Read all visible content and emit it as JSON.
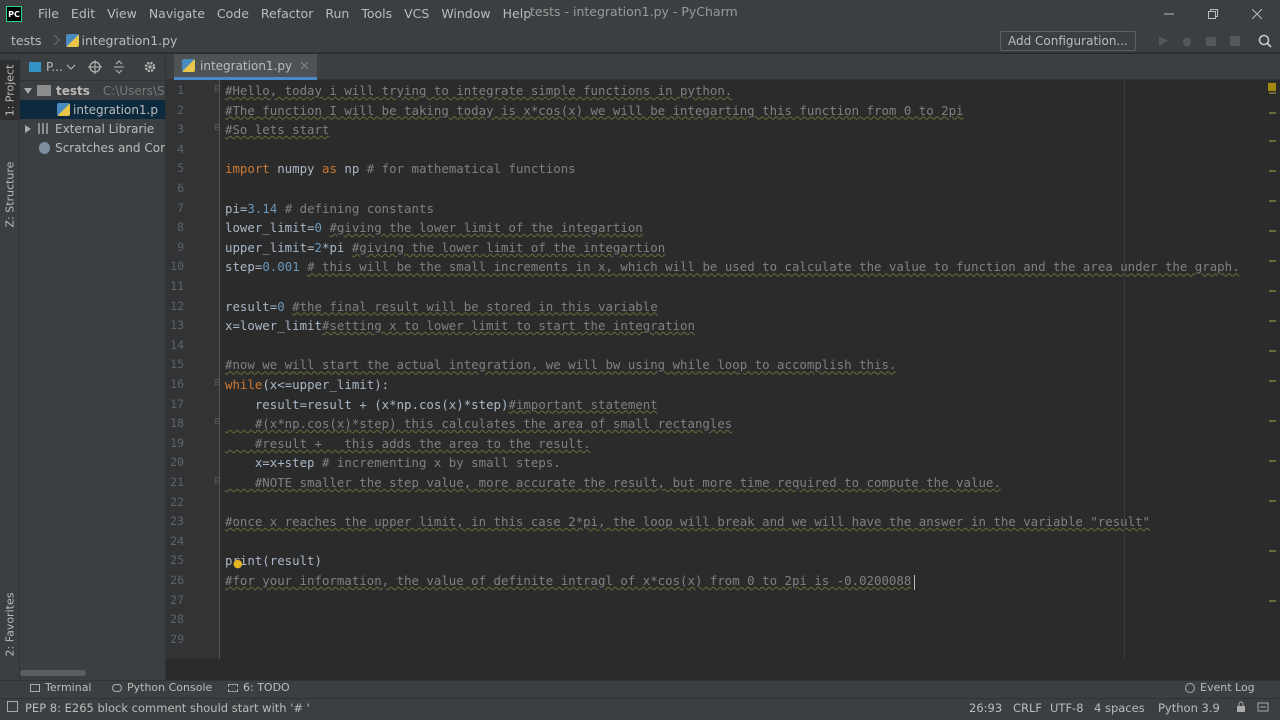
{
  "menubar": {
    "logo": "PC",
    "items": [
      "File",
      "Edit",
      "View",
      "Navigate",
      "Code",
      "Refactor",
      "Run",
      "Tools",
      "VCS",
      "Window",
      "Help"
    ],
    "window_title": "tests - integration1.py - PyCharm"
  },
  "navbar": {
    "crumb_project": "tests",
    "crumb_file": "integration1.py",
    "add_configuration": "Add Configuration..."
  },
  "left_strip": {
    "project_tab": "1: Project",
    "structure_tab": "Z: Structure",
    "favorites_tab": "2: Favorites"
  },
  "project_panel": {
    "title": "P...",
    "tree": {
      "root_label": "tests",
      "root_path": "C:\\Users\\S",
      "file_label": "integration1.p",
      "external_label": "External Librarie",
      "scratches_label": "Scratches and Cor"
    }
  },
  "editor": {
    "tab_label": "integration1.py",
    "lines": [
      {
        "n": "1",
        "parts": [
          {
            "t": "#Hello, today i will trying to integrate simple functions in python.",
            "c": "cm"
          }
        ]
      },
      {
        "n": "2",
        "parts": [
          {
            "t": "#The function I will be taking today is x*cos(x) we will be integarting this function from 0 to 2pi",
            "c": "cm"
          }
        ]
      },
      {
        "n": "3",
        "parts": [
          {
            "t": "#So lets start",
            "c": "cm"
          }
        ]
      },
      {
        "n": "4",
        "parts": []
      },
      {
        "n": "5",
        "parts": [
          {
            "t": "import ",
            "c": "kw"
          },
          {
            "t": "numpy ",
            "c": "fn"
          },
          {
            "t": "as ",
            "c": "kw"
          },
          {
            "t": "np ",
            "c": "fn"
          },
          {
            "t": "# for mathematical functions",
            "c": "cmn"
          }
        ]
      },
      {
        "n": "6",
        "parts": []
      },
      {
        "n": "7",
        "parts": [
          {
            "t": "pi=",
            "c": "fn"
          },
          {
            "t": "3.14 ",
            "c": "num"
          },
          {
            "t": "# defining constants",
            "c": "cmn"
          }
        ]
      },
      {
        "n": "8",
        "parts": [
          {
            "t": "lower_limit=",
            "c": "fn"
          },
          {
            "t": "0 ",
            "c": "num"
          },
          {
            "t": "#giving the lower limit of the integartion",
            "c": "cm"
          }
        ]
      },
      {
        "n": "9",
        "parts": [
          {
            "t": "upper_limit=",
            "c": "fn"
          },
          {
            "t": "2",
            "c": "num"
          },
          {
            "t": "*pi ",
            "c": "fn"
          },
          {
            "t": "#giving the lower limit of the integartion",
            "c": "cm"
          }
        ]
      },
      {
        "n": "10",
        "parts": [
          {
            "t": "step=",
            "c": "fn"
          },
          {
            "t": "0.001 ",
            "c": "num"
          },
          {
            "t": "# this will be the small increments in x, which will be used to calculate the value to function and the area under the graph.",
            "c": "cm"
          }
        ]
      },
      {
        "n": "11",
        "parts": []
      },
      {
        "n": "12",
        "parts": [
          {
            "t": "result=",
            "c": "fn"
          },
          {
            "t": "0 ",
            "c": "num"
          },
          {
            "t": "#the final result will be stored in this variable",
            "c": "cm"
          }
        ]
      },
      {
        "n": "13",
        "parts": [
          {
            "t": "x=lower_limit",
            "c": "fn"
          },
          {
            "t": "#setting x to lower limit to start the integration",
            "c": "cm"
          }
        ]
      },
      {
        "n": "14",
        "parts": []
      },
      {
        "n": "15",
        "parts": [
          {
            "t": "#now we will start the actual integration, we will bw using while loop to accomplish this.",
            "c": "cm"
          }
        ]
      },
      {
        "n": "16",
        "parts": [
          {
            "t": "while",
            "c": "kw"
          },
          {
            "t": "(x<=upper_limit):",
            "c": "fn"
          }
        ]
      },
      {
        "n": "17",
        "parts": [
          {
            "t": "    result=result + (x*np.cos(x)*step)",
            "c": "fn"
          },
          {
            "t": "#important statement",
            "c": "cm"
          }
        ]
      },
      {
        "n": "18",
        "parts": [
          {
            "t": "    #(x*np.cos(x)*step) this calculates the area of small rectangles",
            "c": "cm"
          }
        ]
      },
      {
        "n": "19",
        "parts": [
          {
            "t": "    #result +   this adds the area to the result.",
            "c": "cm"
          }
        ]
      },
      {
        "n": "20",
        "parts": [
          {
            "t": "    x=x+step ",
            "c": "fn"
          },
          {
            "t": "# incrementing x by small steps.",
            "c": "cmn"
          }
        ]
      },
      {
        "n": "21",
        "parts": [
          {
            "t": "    #NOTE smaller the step value, more accurate the result, but more time required to compute the value.",
            "c": "cm"
          }
        ]
      },
      {
        "n": "22",
        "parts": []
      },
      {
        "n": "23",
        "parts": [
          {
            "t": "#once x reaches the upper limit, in this case 2*pi, the loop will break and we will have the answer in the variable \"result\"",
            "c": "cm"
          }
        ]
      },
      {
        "n": "24",
        "parts": []
      },
      {
        "n": "25",
        "parts": [
          {
            "t": "print(result)",
            "c": "fn"
          }
        ]
      },
      {
        "n": "26",
        "parts": [
          {
            "t": "#for your information, the value of definite intragl of x*cos(x) from 0 to 2pi is -0.0200088",
            "c": "cm"
          }
        ]
      },
      {
        "n": "27",
        "parts": []
      },
      {
        "n": "28",
        "parts": []
      },
      {
        "n": "29",
        "parts": []
      }
    ]
  },
  "tool_windows": {
    "terminal": "Terminal",
    "python_console": "Python Console",
    "todo": "6: TODO",
    "event_log": "Event Log"
  },
  "status": {
    "message": "PEP 8: E265 block comment should start with '# '",
    "position": "26:93",
    "line_sep": "CRLF",
    "encoding": "UTF-8",
    "indent": "4 spaces",
    "interpreter": "Python 3.9"
  },
  "colors": {
    "keyword": "#cc7832",
    "number": "#6897bb",
    "comment": "#808080",
    "identifier": "#a9b7c6",
    "tab_underline": "#4a88c7"
  }
}
